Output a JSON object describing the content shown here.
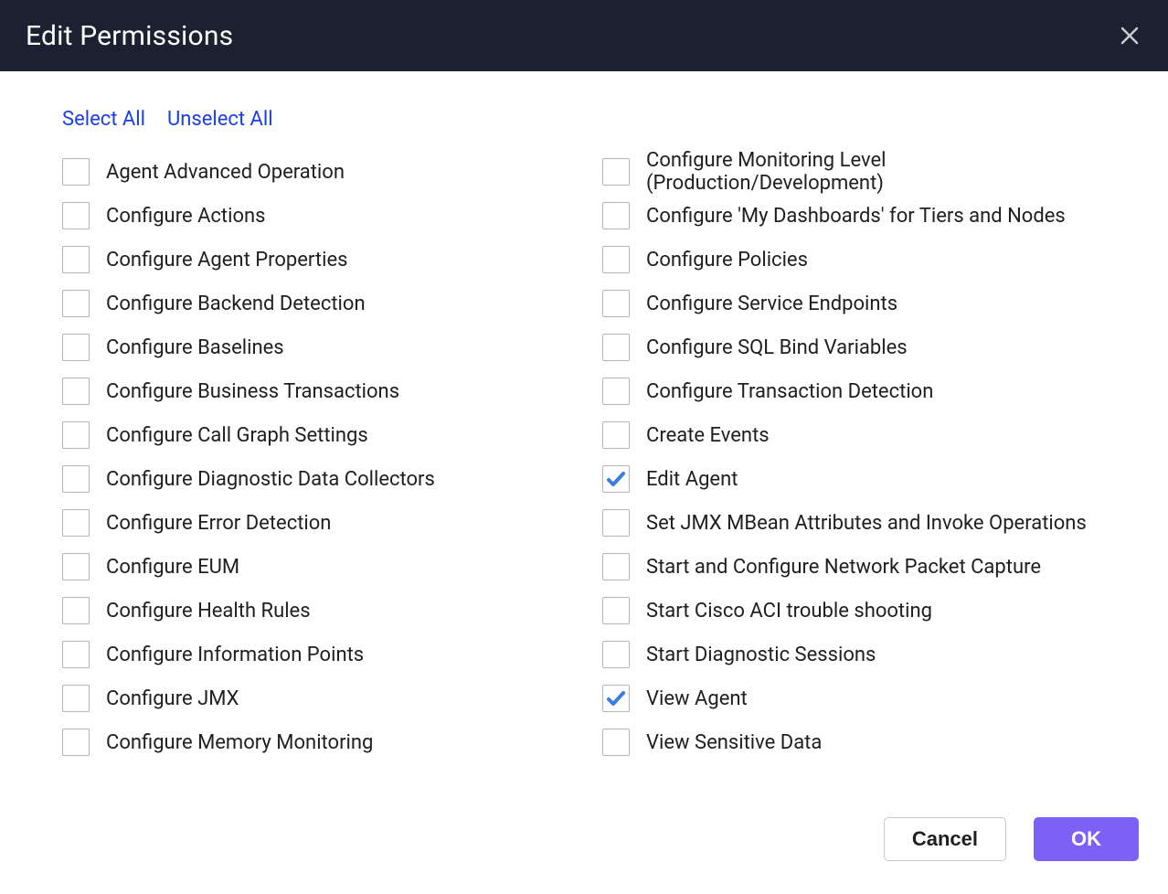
{
  "header": {
    "title": "Edit Permissions"
  },
  "links": {
    "select_all": "Select All",
    "unselect_all": "Unselect All"
  },
  "permissions_left": [
    {
      "label": "Agent Advanced Operation",
      "checked": false
    },
    {
      "label": "Configure Actions",
      "checked": false
    },
    {
      "label": "Configure Agent Properties",
      "checked": false
    },
    {
      "label": "Configure Backend Detection",
      "checked": false
    },
    {
      "label": "Configure Baselines",
      "checked": false
    },
    {
      "label": "Configure Business Transactions",
      "checked": false
    },
    {
      "label": "Configure Call Graph Settings",
      "checked": false
    },
    {
      "label": "Configure Diagnostic Data Collectors",
      "checked": false
    },
    {
      "label": "Configure Error Detection",
      "checked": false
    },
    {
      "label": "Configure EUM",
      "checked": false
    },
    {
      "label": "Configure Health Rules",
      "checked": false
    },
    {
      "label": "Configure Information Points",
      "checked": false
    },
    {
      "label": "Configure JMX",
      "checked": false
    },
    {
      "label": "Configure Memory Monitoring",
      "checked": false
    }
  ],
  "permissions_right": [
    {
      "label": "Configure Monitoring Level (Production/Development)",
      "checked": false
    },
    {
      "label": "Configure 'My Dashboards' for Tiers and Nodes",
      "checked": false
    },
    {
      "label": "Configure Policies",
      "checked": false
    },
    {
      "label": "Configure Service Endpoints",
      "checked": false
    },
    {
      "label": "Configure SQL Bind Variables",
      "checked": false
    },
    {
      "label": "Configure Transaction Detection",
      "checked": false
    },
    {
      "label": "Create Events",
      "checked": false
    },
    {
      "label": "Edit Agent",
      "checked": true
    },
    {
      "label": "Set JMX MBean Attributes and Invoke Operations",
      "checked": false
    },
    {
      "label": "Start and Configure Network Packet Capture",
      "checked": false
    },
    {
      "label": "Start Cisco ACI trouble shooting",
      "checked": false
    },
    {
      "label": "Start Diagnostic Sessions",
      "checked": false
    },
    {
      "label": "View Agent",
      "checked": true
    },
    {
      "label": "View Sensitive Data",
      "checked": false
    }
  ],
  "footer": {
    "cancel": "Cancel",
    "ok": "OK"
  }
}
